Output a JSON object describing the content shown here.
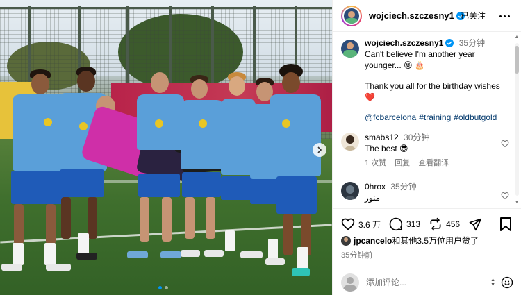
{
  "post": {
    "username": "wojciech.szczesny1",
    "follow_label": "已关注",
    "caption": {
      "username": "wojciech.szczesny1",
      "time": "35分钟",
      "line1": "Can't believe I'm another year",
      "line2": "younger...",
      "line2_emojis": "😜 🎂",
      "line3": "Thank you all for the birthday wishes",
      "line3_emoji": "❤️",
      "hashtags": [
        "@fcbarcelona",
        "#training",
        "#oldbutgold"
      ]
    },
    "comments": [
      {
        "username": "smabs12",
        "time": "30分钟",
        "text": "The best",
        "emoji": "😎",
        "likes_label": "1 次赞",
        "reply_label": "回复",
        "translate_label": "查看翻译"
      },
      {
        "username": "0hrox",
        "time": "35分钟",
        "text": "منور"
      }
    ],
    "likes_count": "3.6 万",
    "comments_count": "313",
    "shares_count": "456",
    "liked_by_user": "jpcancelo",
    "liked_by_rest": "和其他3.5万位用户赞了",
    "posted_time": "35分钟前",
    "comment_placeholder": "添加评论..."
  },
  "colors": {
    "link": "#00376b",
    "muted": "#737373",
    "accent": "#0095f6",
    "gk_kit": "#cf2fa8",
    "team_kit": "#5a9fd9"
  }
}
